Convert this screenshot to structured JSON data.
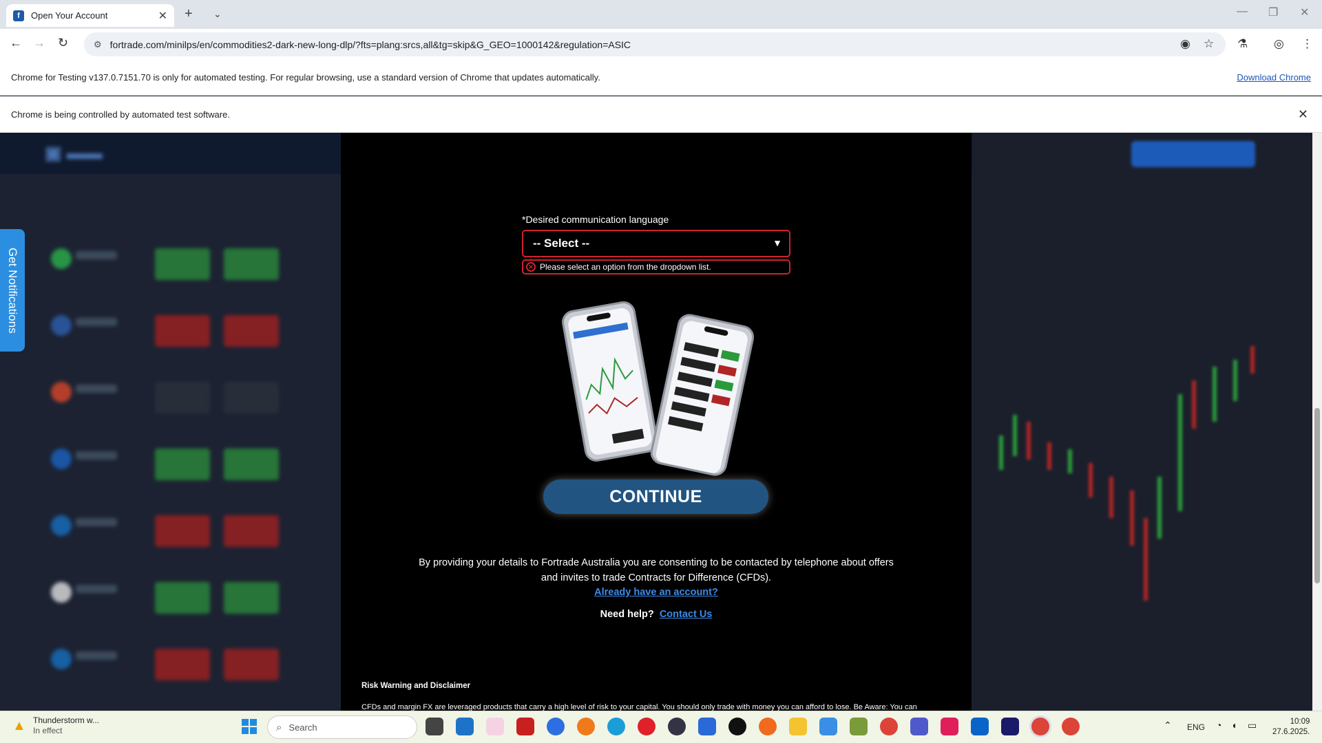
{
  "browser": {
    "tab_title": "Open Your Account",
    "favicon_letter": "f",
    "url": "fortrade.com/minilps/en/commodities2-dark-new-long-dlp/?fts=plang:srcs,all&tg=skip&G_GEO=1000142&regulation=ASIC",
    "testing_notice": "Chrome for Testing v137.0.7151.70 is only for automated testing. For regular browsing, use a standard version of Chrome that updates automatically.",
    "download_link": "Download Chrome",
    "automation_notice": "Chrome is being controlled by automated test software."
  },
  "sidebar_tab": {
    "label": "Get Notifications"
  },
  "modal": {
    "language_label": "*Desired communication language",
    "language_select_value": "-- Select --",
    "language_error": "Please select an option from the dropdown list.",
    "continue_label": "CONTINUE",
    "consent_text": "By providing your details to Fortrade Australia you are consenting to be contacted by telephone about offers and invites to trade Contracts for Difference (CFDs).",
    "already_account": "Already have an account?",
    "help_label": "Need help?",
    "contact_link": "Contact Us",
    "risk_title": "Risk Warning and Disclaimer",
    "risk_text": "CFDs and margin FX are leveraged products that carry a high level of risk to your capital. You should only trade with money you can afford to lose. Be Aware: You can"
  },
  "taskbar": {
    "weather_title": "Thunderstorm w...",
    "weather_sub": "In effect",
    "search_placeholder": "Search",
    "language": "ENG",
    "time": "10:09",
    "date": "27.6.2025."
  },
  "colors": {
    "accent_blue": "#215481",
    "error_red": "#d0212f",
    "link_blue": "#3d8ae6",
    "notif_blue": "#2c8ee0"
  }
}
